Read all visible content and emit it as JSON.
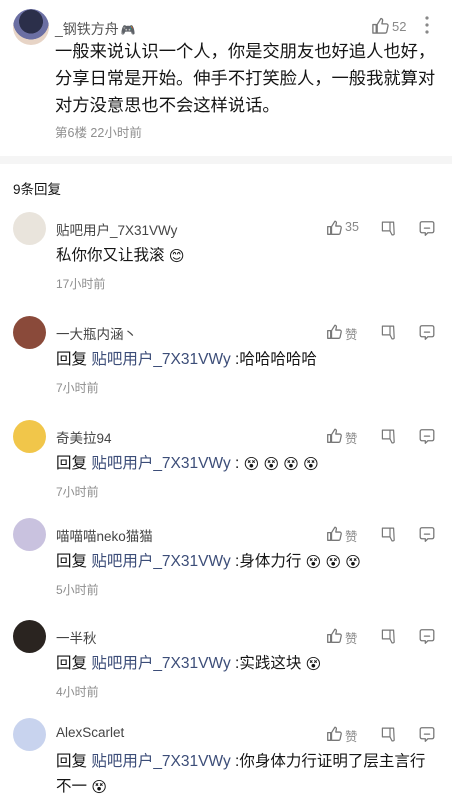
{
  "main_post": {
    "author": "_钢铁方舟",
    "author_badge": "🎮",
    "like_count": "52",
    "text": "一般来说认识一个人，你是交朋友也好追人也好，分享日常是开始。伸手不打笑脸人，一般我就算对对方没意思也不会这样说话。",
    "meta": "第6楼 22小时前"
  },
  "replies_header": "9条回复",
  "replies": [
    {
      "name": "贴吧用户_7X31VWy",
      "prefix": "",
      "mention": "",
      "body": "私你你又让我滚",
      "emojis": "😊",
      "time": "17小时前",
      "like_label": "35",
      "avatar_color": "#e9e4dc"
    },
    {
      "name": "一大瓶内涵丶",
      "prefix": "回复 ",
      "mention": "贴吧用户_7X31VWy",
      "body": " :哈哈哈哈哈",
      "emojis": "",
      "time": "7小时前",
      "like_label": "赞",
      "avatar_color": "#8a4a3a"
    },
    {
      "name": "奇美拉94",
      "prefix": "回复 ",
      "mention": "贴吧用户_7X31VWy",
      "body": " :",
      "emojis": "😵 😵 😵 😵",
      "time": "7小时前",
      "like_label": "赞",
      "avatar_color": "#f1c64a"
    },
    {
      "name": "喵喵喵neko猫猫",
      "prefix": "回复 ",
      "mention": "贴吧用户_7X31VWy",
      "body": " :身体力行",
      "emojis": "😵 😵 😵",
      "time": "5小时前",
      "like_label": "赞",
      "avatar_color": "#c9c2df"
    },
    {
      "name": "一半秋",
      "prefix": "回复 ",
      "mention": "贴吧用户_7X31VWy",
      "body": " :实践这块",
      "emojis": "😵",
      "time": "4小时前",
      "like_label": "赞",
      "avatar_color": "#2a2420"
    },
    {
      "name": "AlexScarlet",
      "prefix": "回复 ",
      "mention": "贴吧用户_7X31VWy",
      "body": " :你身体力行证明了层主言行不一",
      "emojis": "😵",
      "time": "",
      "like_label": "赞",
      "avatar_color": "#c8d3ee"
    }
  ],
  "colors": {
    "mention": "#3c4d78",
    "meta_gray": "#8e8e8e",
    "divider": "#f5f5f5"
  }
}
